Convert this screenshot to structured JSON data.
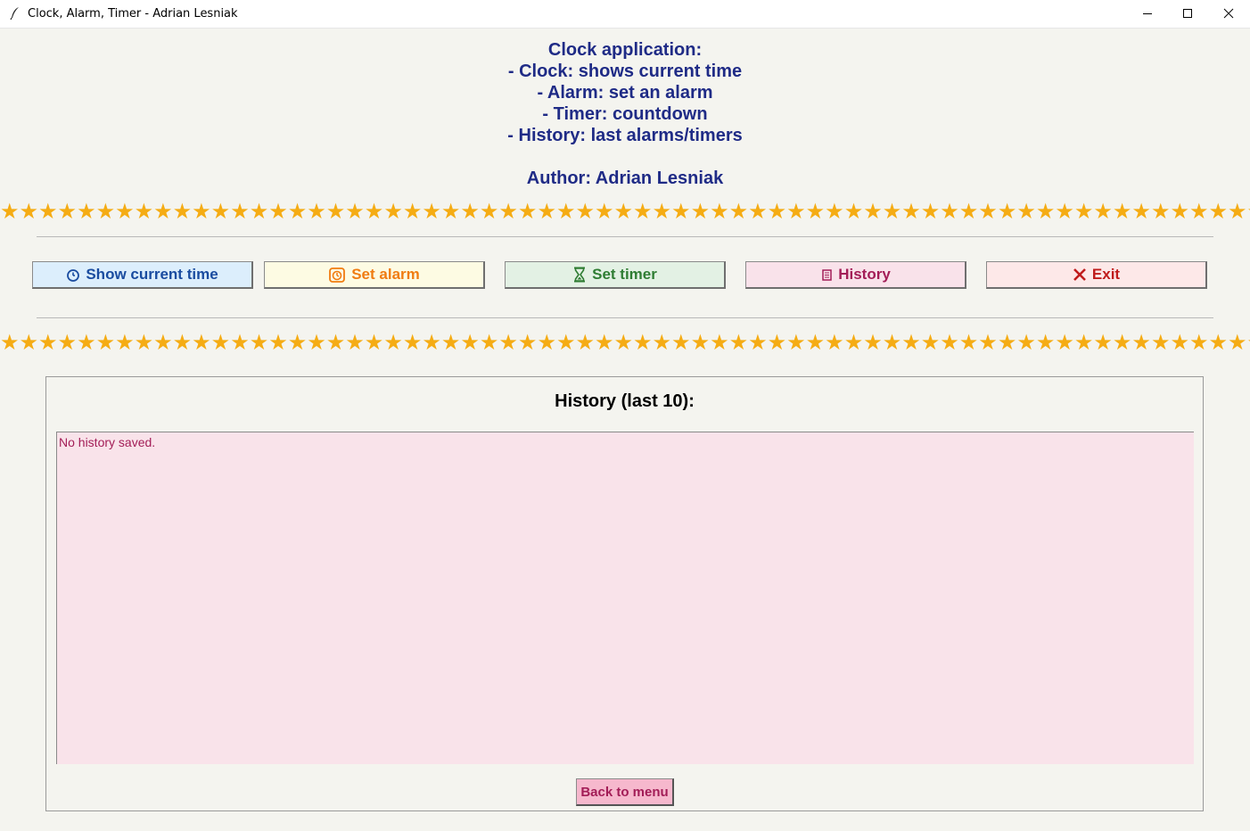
{
  "window": {
    "title": "Clock, Alarm, Timer - Adrian Lesniak"
  },
  "intro": {
    "lines": [
      "Clock application:",
      "- Clock: shows current time",
      "- Alarm: set an alarm",
      "- Timer: countdown",
      "- History: last alarms/timers",
      "",
      "Author: Adrian Lesniak"
    ]
  },
  "decor": {
    "stars": "★★★★★★★★★★★★★★★★★★★★★★★★★★★★★★★★★★★★★★★★★★★★★★★★★★★★★★★★★★★★★★★★★★★★★★★★★★★★★★★★★★★★★★★★★★★★★★★★★★★★★★★★★★★★★★★★★★★★★★★★★★",
    "star_color": "#f5ac14"
  },
  "menu": {
    "buttons": [
      {
        "label": "Show current time",
        "icon": "clock-icon",
        "bg": "#dceefc",
        "fg": "#1a4ca0"
      },
      {
        "label": "Set alarm",
        "icon": "alarm-clock-icon",
        "bg": "#fdfbe3",
        "fg": "#f07c11"
      },
      {
        "label": "Set timer",
        "icon": "hourglass-icon",
        "bg": "#e3f1e4",
        "fg": "#2f7d33"
      },
      {
        "label": "History",
        "icon": "scroll-icon",
        "bg": "#f9e2ea",
        "fg": "#a31d57"
      },
      {
        "label": "Exit",
        "icon": "close-x-icon",
        "bg": "#fde8e8",
        "fg": "#c01c1c"
      }
    ]
  },
  "history_panel": {
    "title": "History (last 10):",
    "content": "No history saved.",
    "back_label": "Back to menu"
  },
  "colors": {
    "title_text": "#1f2b86",
    "background": "#f4f4ef",
    "history_bg": "#f9e3ea",
    "history_text": "#a31d57"
  }
}
